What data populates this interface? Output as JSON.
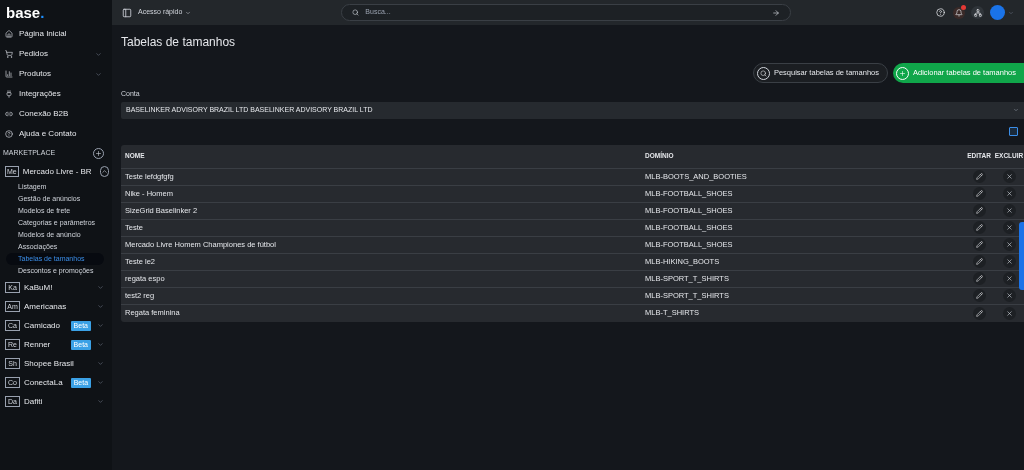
{
  "logo": {
    "text": "base",
    "dot": "."
  },
  "sidebar": {
    "items": [
      {
        "kind": "home",
        "label": "Página Inicial",
        "expandable": false
      },
      {
        "kind": "cart",
        "label": "Pedidos",
        "expandable": true
      },
      {
        "kind": "products",
        "label": "Produtos",
        "expandable": true
      },
      {
        "kind": "plug",
        "label": "Integrações",
        "expandable": false
      },
      {
        "kind": "link",
        "label": "Conexão B2B",
        "expandable": false
      },
      {
        "kind": "help",
        "label": "Ajuda e Contato",
        "expandable": false
      }
    ],
    "section_title": "MARKETPLACE",
    "marketplaces": [
      {
        "code": "Me",
        "label": "Mercado Livre - BR",
        "expanded": true,
        "children": [
          {
            "label": "Listagem",
            "selected": false
          },
          {
            "label": "Gestão de anúncios",
            "selected": false
          },
          {
            "label": "Modelos de frete",
            "selected": false
          },
          {
            "label": "Categorias e parâmetros",
            "selected": false
          },
          {
            "label": "Modelos de anúncio",
            "selected": false
          },
          {
            "label": "Associações",
            "selected": false
          },
          {
            "label": "Tabelas de tamanhos",
            "selected": true
          },
          {
            "label": "Descontos e promoções",
            "selected": false
          }
        ]
      },
      {
        "code": "Ka",
        "label": "KaBuM!",
        "expanded": false
      },
      {
        "code": "Am",
        "label": "Americanas",
        "expanded": false
      },
      {
        "code": "Ca",
        "label": "Camicado",
        "expanded": false,
        "beta": "Beta"
      },
      {
        "code": "Re",
        "label": "Renner",
        "expanded": false,
        "beta": "Beta"
      },
      {
        "code": "Sh",
        "label": "Shopee Brasil",
        "expanded": false
      },
      {
        "code": "Co",
        "label": "ConectaLa",
        "expanded": false,
        "beta": "Beta"
      },
      {
        "code": "Da",
        "label": "Dafiti",
        "expanded": false
      }
    ]
  },
  "topbar": {
    "quick_access": "Acesso rápido",
    "search": {
      "placeholder": "Busca..."
    }
  },
  "page": {
    "title": "Tabelas de tamanhos",
    "search_button": "Pesquisar tabelas de tamanhos",
    "add_button": "Adicionar tabelas de tamanhos",
    "account": {
      "label": "Conta",
      "value": "BASELINKER ADVISORY BRAZIL LTD BASELINKER ADVISORY BRAZIL LTD"
    }
  },
  "table": {
    "columns": [
      "NOME",
      "DOMÍNIO",
      "EDITAR",
      "EXCLUIR"
    ],
    "rows": [
      {
        "name": "Teste lefdgfgfg",
        "domain": "MLB-BOOTS_AND_BOOTIES"
      },
      {
        "name": "Nike - Homem",
        "domain": "MLB-FOOTBALL_SHOES"
      },
      {
        "name": "SizeGrid Baselinker 2",
        "domain": "MLB-FOOTBALL_SHOES"
      },
      {
        "name": "Teste",
        "domain": "MLB-FOOTBALL_SHOES"
      },
      {
        "name": "Mercado Livre Homem Championes de fútbol",
        "domain": "MLB-FOOTBALL_SHOES"
      },
      {
        "name": "Teste le2",
        "domain": "MLB-HIKING_BOOTS"
      },
      {
        "name": "regata espo",
        "domain": "MLB-SPORT_T_SHIRTS"
      },
      {
        "name": "test2 reg",
        "domain": "MLB-SPORT_T_SHIRTS"
      },
      {
        "name": "Regata feminina",
        "domain": "MLB-T_SHIRTS"
      }
    ]
  }
}
